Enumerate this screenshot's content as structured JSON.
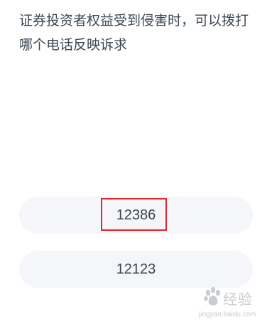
{
  "question": {
    "text": "证券投资者权益受到侵害时，可以拨打哪个电话反映诉求"
  },
  "options": [
    {
      "label": "12386",
      "highlighted": true
    },
    {
      "label": "12123",
      "highlighted": false
    }
  ],
  "highlight_color": "#e0252b",
  "watermark": {
    "brand": "经验",
    "url": "jingyan.baidu.com",
    "icon": "baidu-paw-icon"
  }
}
